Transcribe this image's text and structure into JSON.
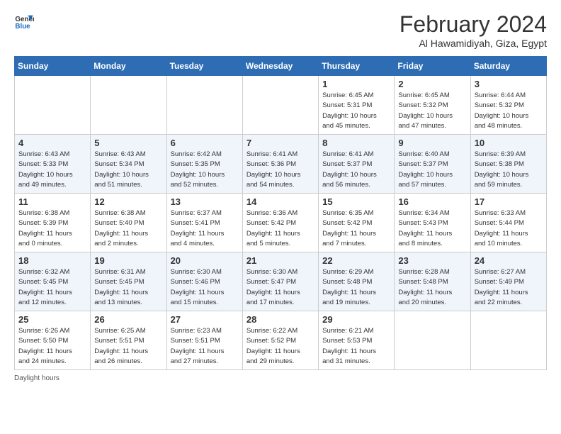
{
  "logo": {
    "line1": "General",
    "line2": "Blue"
  },
  "title": "February 2024",
  "location": "Al Hawamidiyah, Giza, Egypt",
  "days_of_week": [
    "Sunday",
    "Monday",
    "Tuesday",
    "Wednesday",
    "Thursday",
    "Friday",
    "Saturday"
  ],
  "weeks": [
    [
      {
        "day": "",
        "info": ""
      },
      {
        "day": "",
        "info": ""
      },
      {
        "day": "",
        "info": ""
      },
      {
        "day": "",
        "info": ""
      },
      {
        "day": "1",
        "info": "Sunrise: 6:45 AM\nSunset: 5:31 PM\nDaylight: 10 hours\nand 45 minutes."
      },
      {
        "day": "2",
        "info": "Sunrise: 6:45 AM\nSunset: 5:32 PM\nDaylight: 10 hours\nand 47 minutes."
      },
      {
        "day": "3",
        "info": "Sunrise: 6:44 AM\nSunset: 5:32 PM\nDaylight: 10 hours\nand 48 minutes."
      }
    ],
    [
      {
        "day": "4",
        "info": "Sunrise: 6:43 AM\nSunset: 5:33 PM\nDaylight: 10 hours\nand 49 minutes."
      },
      {
        "day": "5",
        "info": "Sunrise: 6:43 AM\nSunset: 5:34 PM\nDaylight: 10 hours\nand 51 minutes."
      },
      {
        "day": "6",
        "info": "Sunrise: 6:42 AM\nSunset: 5:35 PM\nDaylight: 10 hours\nand 52 minutes."
      },
      {
        "day": "7",
        "info": "Sunrise: 6:41 AM\nSunset: 5:36 PM\nDaylight: 10 hours\nand 54 minutes."
      },
      {
        "day": "8",
        "info": "Sunrise: 6:41 AM\nSunset: 5:37 PM\nDaylight: 10 hours\nand 56 minutes."
      },
      {
        "day": "9",
        "info": "Sunrise: 6:40 AM\nSunset: 5:37 PM\nDaylight: 10 hours\nand 57 minutes."
      },
      {
        "day": "10",
        "info": "Sunrise: 6:39 AM\nSunset: 5:38 PM\nDaylight: 10 hours\nand 59 minutes."
      }
    ],
    [
      {
        "day": "11",
        "info": "Sunrise: 6:38 AM\nSunset: 5:39 PM\nDaylight: 11 hours\nand 0 minutes."
      },
      {
        "day": "12",
        "info": "Sunrise: 6:38 AM\nSunset: 5:40 PM\nDaylight: 11 hours\nand 2 minutes."
      },
      {
        "day": "13",
        "info": "Sunrise: 6:37 AM\nSunset: 5:41 PM\nDaylight: 11 hours\nand 4 minutes."
      },
      {
        "day": "14",
        "info": "Sunrise: 6:36 AM\nSunset: 5:42 PM\nDaylight: 11 hours\nand 5 minutes."
      },
      {
        "day": "15",
        "info": "Sunrise: 6:35 AM\nSunset: 5:42 PM\nDaylight: 11 hours\nand 7 minutes."
      },
      {
        "day": "16",
        "info": "Sunrise: 6:34 AM\nSunset: 5:43 PM\nDaylight: 11 hours\nand 8 minutes."
      },
      {
        "day": "17",
        "info": "Sunrise: 6:33 AM\nSunset: 5:44 PM\nDaylight: 11 hours\nand 10 minutes."
      }
    ],
    [
      {
        "day": "18",
        "info": "Sunrise: 6:32 AM\nSunset: 5:45 PM\nDaylight: 11 hours\nand 12 minutes."
      },
      {
        "day": "19",
        "info": "Sunrise: 6:31 AM\nSunset: 5:45 PM\nDaylight: 11 hours\nand 13 minutes."
      },
      {
        "day": "20",
        "info": "Sunrise: 6:30 AM\nSunset: 5:46 PM\nDaylight: 11 hours\nand 15 minutes."
      },
      {
        "day": "21",
        "info": "Sunrise: 6:30 AM\nSunset: 5:47 PM\nDaylight: 11 hours\nand 17 minutes."
      },
      {
        "day": "22",
        "info": "Sunrise: 6:29 AM\nSunset: 5:48 PM\nDaylight: 11 hours\nand 19 minutes."
      },
      {
        "day": "23",
        "info": "Sunrise: 6:28 AM\nSunset: 5:48 PM\nDaylight: 11 hours\nand 20 minutes."
      },
      {
        "day": "24",
        "info": "Sunrise: 6:27 AM\nSunset: 5:49 PM\nDaylight: 11 hours\nand 22 minutes."
      }
    ],
    [
      {
        "day": "25",
        "info": "Sunrise: 6:26 AM\nSunset: 5:50 PM\nDaylight: 11 hours\nand 24 minutes."
      },
      {
        "day": "26",
        "info": "Sunrise: 6:25 AM\nSunset: 5:51 PM\nDaylight: 11 hours\nand 26 minutes."
      },
      {
        "day": "27",
        "info": "Sunrise: 6:23 AM\nSunset: 5:51 PM\nDaylight: 11 hours\nand 27 minutes."
      },
      {
        "day": "28",
        "info": "Sunrise: 6:22 AM\nSunset: 5:52 PM\nDaylight: 11 hours\nand 29 minutes."
      },
      {
        "day": "29",
        "info": "Sunrise: 6:21 AM\nSunset: 5:53 PM\nDaylight: 11 hours\nand 31 minutes."
      },
      {
        "day": "",
        "info": ""
      },
      {
        "day": "",
        "info": ""
      }
    ]
  ],
  "footer": "Daylight hours"
}
